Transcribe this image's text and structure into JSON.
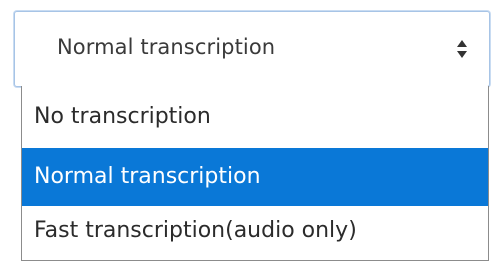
{
  "select": {
    "selected_value": "Normal transcription",
    "arrow_icon": "up-down-sort-icon"
  },
  "dropdown": {
    "options": [
      {
        "label": "No transcription",
        "highlighted": false
      },
      {
        "label": "Normal transcription",
        "highlighted": true
      },
      {
        "label": "Fast transcription(audio only)",
        "highlighted": false
      }
    ],
    "highlight_color": "#0a78d7"
  }
}
